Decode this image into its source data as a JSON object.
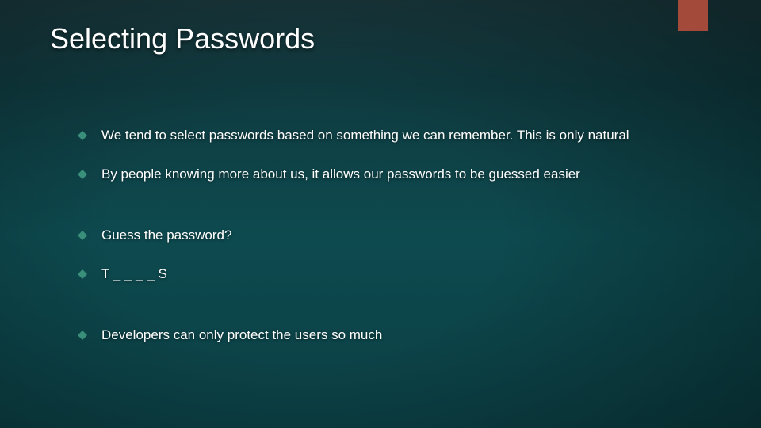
{
  "accent_color": "#a34a3a",
  "bullet_fill": "#3a8f7a",
  "title": "Selecting Passwords",
  "bullets": [
    {
      "text": "We tend to select passwords based on something we can remember. This is only natural",
      "gap_after": false
    },
    {
      "text": "By people knowing more about us, it allows our passwords to be guessed easier",
      "gap_after": true
    },
    {
      "text": "Guess the password?",
      "gap_after": false
    },
    {
      "text": "T _ _ _ _ S",
      "gap_after": true
    },
    {
      "text": "Developers can only protect the users so much",
      "gap_after": false
    }
  ]
}
